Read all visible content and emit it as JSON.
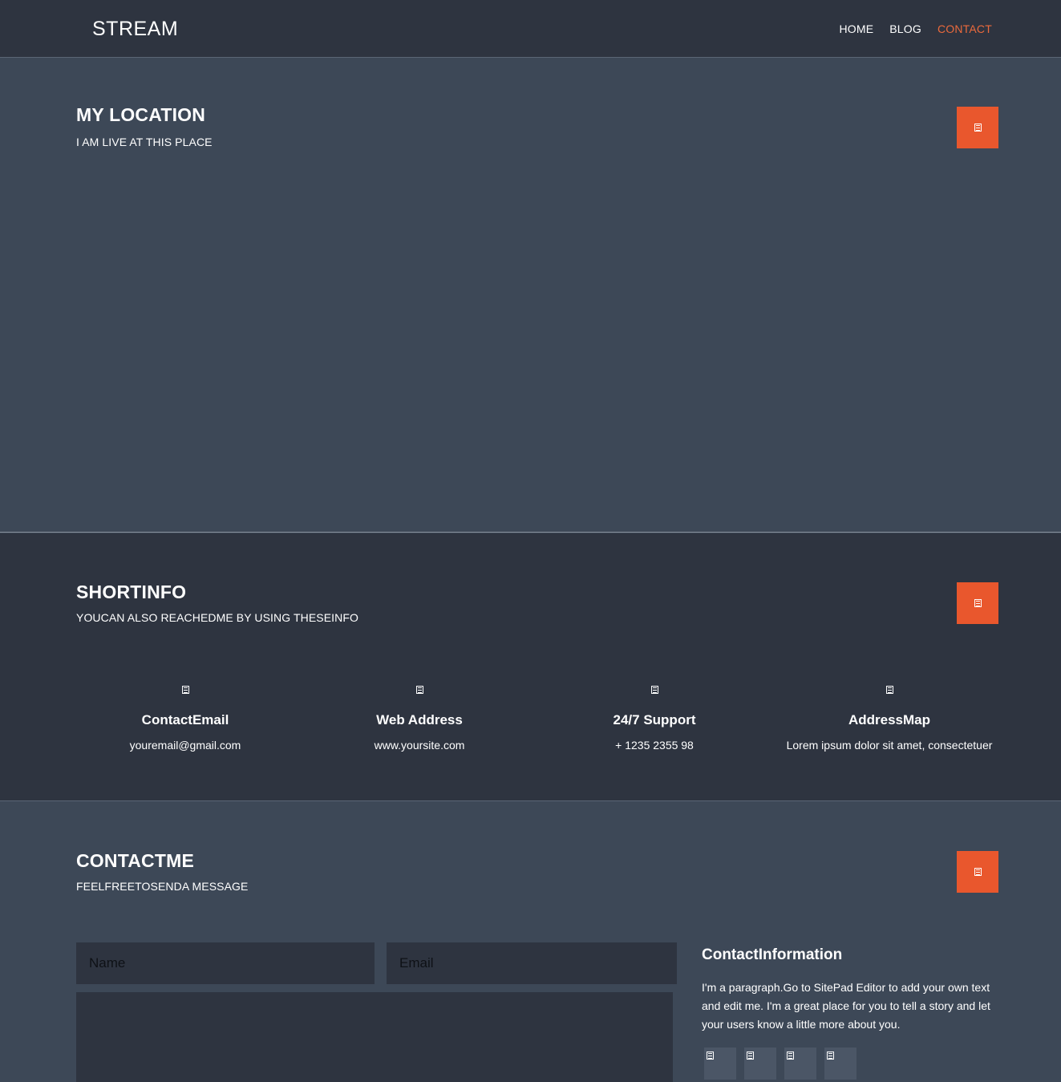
{
  "navbar": {
    "brand": "STREAM",
    "items": [
      {
        "label": "HOME",
        "active": false
      },
      {
        "label": "BLOG",
        "active": false
      },
      {
        "label": "CONTACT",
        "active": true
      }
    ]
  },
  "location": {
    "title": "MY LOCATION",
    "subtitle": "I AM LIVE AT THIS PLACE",
    "icon": "location-glyph-icon"
  },
  "short_info": {
    "title": "SHORTINFO",
    "subtitle": "YOUCAN ALSO REACHEDME BY USING THESEINFO",
    "icon": "info-glyph-icon",
    "items": [
      {
        "heading": "ContactEmail",
        "value": "youremail@gmail.com",
        "icon": "email-icon"
      },
      {
        "heading": "Web Address",
        "value": "www.yoursite.com",
        "icon": "globe-icon"
      },
      {
        "heading": "24/7  Support",
        "value": "+ 1235 2355 98",
        "icon": "phone-icon"
      },
      {
        "heading": "AddressMap",
        "value": "Lorem ipsum  dolor sit amet, consectetuer",
        "icon": "map-marker-icon"
      }
    ]
  },
  "contact": {
    "title": "CONTACTME",
    "subtitle": "FEELFREETOSENDA MESSAGE",
    "icon": "envelope-glyph-icon",
    "form": {
      "name_placeholder": "Name",
      "email_placeholder": "Email"
    },
    "info_title": "ContactInformation",
    "info_text": "I'm  a paragraph.Go to SitePad Editor to add your own text and edit me.  I'm  a great place for you to tell a story and let your users know  a little more about you.",
    "social": [
      "facebook-icon",
      "twitter-icon",
      "google-plus-icon",
      "linkedin-icon"
    ]
  },
  "colors": {
    "accent": "#e9572d",
    "nav_active": "#ec6a3c",
    "dark_bg": "#2e3440",
    "light_bg": "#3d4857"
  }
}
